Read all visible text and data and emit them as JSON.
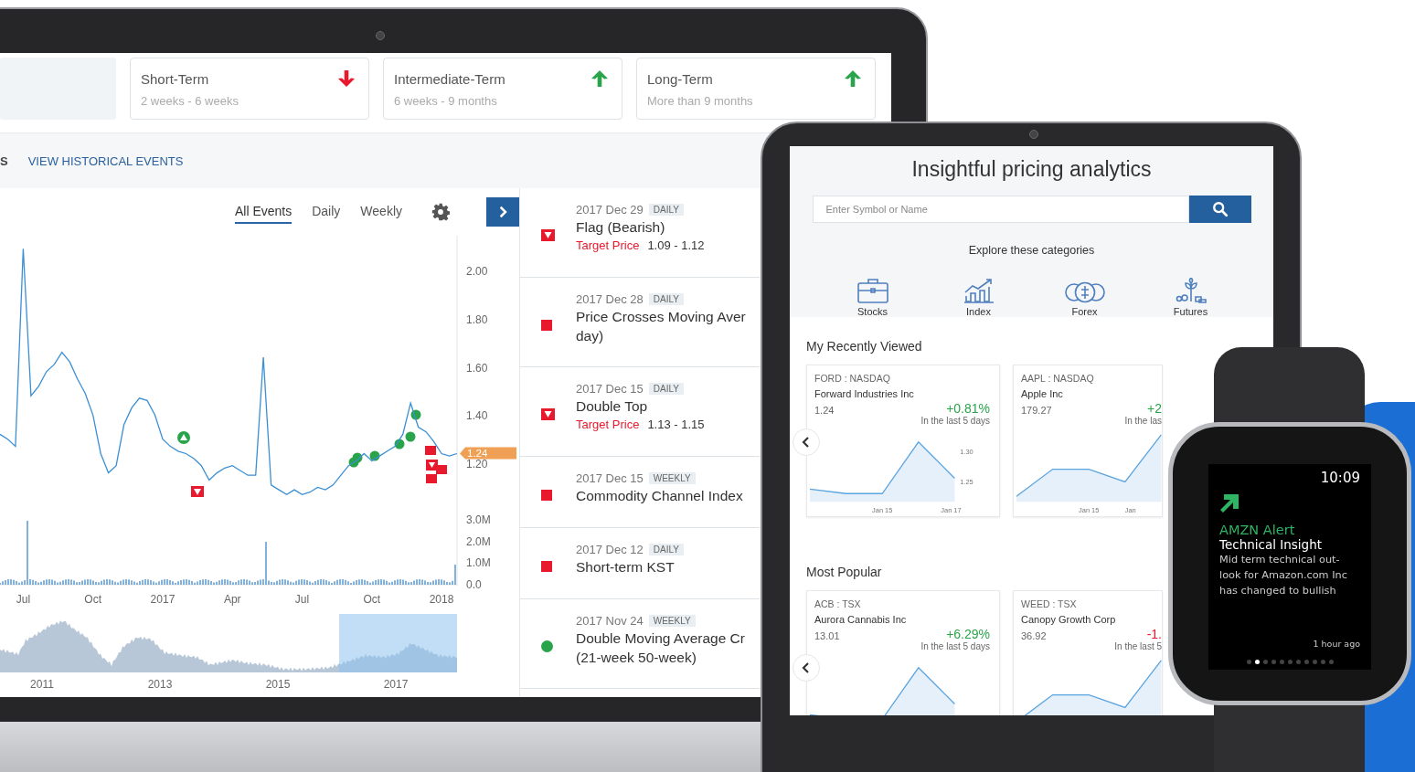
{
  "laptop": {
    "term_cards": [
      {
        "title": "Short-Term",
        "range": "2 weeks - 6 weeks",
        "up": false
      },
      {
        "title": "Intermediate-Term",
        "range": "6 weeks - 9 months",
        "up": true
      },
      {
        "title": "Long-Term",
        "range": "More than 9 months",
        "up": true
      }
    ],
    "section_heading": "S",
    "history_link": "VIEW HISTORICAL EVENTS",
    "tabs": [
      {
        "label": "All Events",
        "selected": true
      },
      {
        "label": "Daily",
        "selected": false
      },
      {
        "label": "Weekly",
        "selected": false
      }
    ],
    "chart_data": {
      "type": "line",
      "ylim": [
        0.696,
        2.144
      ],
      "categories": [
        null,
        null,
        null,
        "Jul",
        null,
        null,
        null,
        null,
        null,
        null,
        null,
        null,
        "Oct",
        null,
        null,
        null,
        null,
        null,
        null,
        null,
        null,
        "2017",
        null,
        null,
        null,
        null,
        null,
        null,
        null,
        null,
        "Apr",
        null,
        null,
        null,
        null,
        null,
        null,
        null,
        null,
        "Jul",
        null,
        null,
        null,
        null,
        null,
        null,
        null,
        null,
        "Oct",
        null,
        null,
        null,
        null,
        null,
        null,
        null,
        null,
        "2018",
        null,
        null
      ],
      "yticks": [
        {
          "value": 2.0,
          "label": "2.00"
        },
        {
          "value": 1.8,
          "label": "1.80"
        },
        {
          "value": 1.6,
          "label": "1.60"
        },
        {
          "value": 1.4,
          "label": "1.40"
        },
        {
          "value": 1.2,
          "label": "1.20"
        }
      ],
      "series": [
        {
          "color": "#3b8fd4",
          "values": [
            1.32,
            1.3,
            1.27,
            2.09,
            1.48,
            1.52,
            1.58,
            1.61,
            1.66,
            1.62,
            1.55,
            1.49,
            1.4,
            1.24,
            1.16,
            1.19,
            1.36,
            1.43,
            1.47,
            1.46,
            1.4,
            1.3,
            1.27,
            1.25,
            1.24,
            1.22,
            1.19,
            1.13,
            1.16,
            1.18,
            1.19,
            1.17,
            1.15,
            1.15,
            1.64,
            1.11,
            1.09,
            1.07,
            1.09,
            1.07,
            1.08,
            1.1,
            1.09,
            1.11,
            1.15,
            1.19,
            1.21,
            1.24,
            1.21,
            1.23,
            1.25,
            1.27,
            1.32,
            1.45,
            1.35,
            1.33,
            1.29,
            1.24,
            1.23,
            1.24
          ]
        }
      ]
    },
    "price_tag": "1.24",
    "volume_ticks": [
      "3.0M",
      "2.0M",
      "1.0M",
      "0.0"
    ],
    "navigator_labels": [
      "2011",
      "2013",
      "2015",
      "2017"
    ],
    "events": [
      {
        "date": "2017 Dec 29",
        "frequency": "DAILY",
        "kind": "bearish-pattern",
        "title": "Flag (Bearish)",
        "target_label": "Target Price",
        "target": "1.09 - 1.12"
      },
      {
        "date": "2017 Dec 28",
        "frequency": "DAILY",
        "kind": "bearish",
        "title": "Price Crosses Moving Aver",
        "title_line_2": "day)"
      },
      {
        "date": "2017 Dec 15",
        "frequency": "DAILY",
        "kind": "bearish-pattern",
        "title": "Double Top",
        "target_label": "Target Price",
        "target": "1.13 - 1.15"
      },
      {
        "date": "2017 Dec 15",
        "frequency": "WEEKLY",
        "kind": "bearish",
        "title": "Commodity Channel Index"
      },
      {
        "date": "2017 Dec 12",
        "frequency": "DAILY",
        "kind": "bearish",
        "title": "Short-term KST"
      },
      {
        "date": "2017 Nov 24",
        "frequency": "WEEKLY",
        "kind": "bullish",
        "title": "Double Moving Average Cr",
        "title_line_2": "(21-week 50-week)"
      }
    ]
  },
  "tablet": {
    "title": "Insightful pricing analytics",
    "search": {
      "placeholder": "Enter Symbol or Name"
    },
    "categories_heading": "Explore these categories",
    "categories": [
      {
        "label": "Stocks",
        "kind": "briefcase"
      },
      {
        "label": "Index",
        "kind": "chart"
      },
      {
        "label": "Forex",
        "kind": "coins"
      },
      {
        "label": "Futures",
        "kind": "plant"
      }
    ],
    "sections": [
      {
        "heading": "My Recently Viewed",
        "cards": [
          {
            "symbol": "FORD : NASDAQ",
            "name": "Forward Industries Inc",
            "price": "1.24",
            "change": "+0.81%",
            "up": true,
            "period": "In the last 5 days",
            "chart_ticks": [
              "1.30",
              "1.25"
            ],
            "chart_dates": [
              "Jan 15",
              "Jan 17"
            ]
          },
          {
            "symbol": "AAPL : NASDAQ",
            "name": "Apple Inc",
            "price": "179.27",
            "change": "+2",
            "up": true,
            "period": "In the las",
            "chart_dates": [
              "Jan 15",
              "Jan"
            ]
          }
        ]
      },
      {
        "heading": "Most Popular",
        "cards": [
          {
            "symbol": "ACB : TSX",
            "name": "Aurora Cannabis Inc",
            "price": "13.01",
            "change": "+6.29%",
            "up": true,
            "period": "In the last 5 days"
          },
          {
            "symbol": "WEED : TSX",
            "name": "Canopy Growth Corp",
            "price": "36.92",
            "change": "-1.",
            "up": false,
            "period": "In the last 5"
          }
        ]
      }
    ]
  },
  "watch": {
    "time": "10:09",
    "alert_title": "AMZN Alert",
    "subtitle": "Technical Insight",
    "message": "Mid term technical out-look for Amazon.com Inc has changed to bullish",
    "age": "1 hour ago",
    "page_dots": [
      {
        "selected": false
      },
      {
        "selected": true
      },
      {
        "selected": false
      },
      {
        "selected": false
      },
      {
        "selected": false
      },
      {
        "selected": false
      },
      {
        "selected": false
      },
      {
        "selected": false
      },
      {
        "selected": false
      },
      {
        "selected": false
      },
      {
        "selected": false
      }
    ]
  }
}
